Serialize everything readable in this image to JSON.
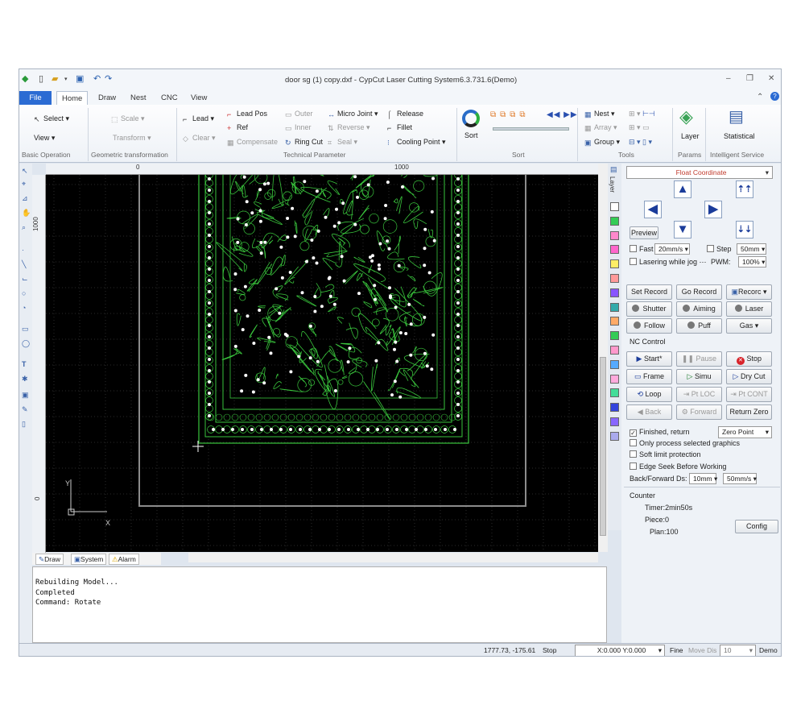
{
  "window": {
    "title": "door sg (1) copy.dxf - CypCut Laser Cutting System6.3.731.6(Demo)"
  },
  "tabs": [
    "File",
    "Home",
    "Draw",
    "Nest",
    "CNC",
    "View"
  ],
  "ribbon": {
    "basic": {
      "select": "Select",
      "view": "View",
      "label": "Basic Operation"
    },
    "geometric": {
      "scale": "Scale",
      "transform": "Transform",
      "label": "Geometric transformation"
    },
    "technical": {
      "lead": "Lead",
      "clear": "Clear",
      "lead_pos": "Lead Pos",
      "ref": "Ref",
      "compensate": "Compensate",
      "outer": "Outer",
      "inner": "Inner",
      "ring_cut": "Ring Cut",
      "micro_joint": "Micro Joint",
      "reverse": "Reverse",
      "seal": "Seal",
      "release": "Release",
      "fillet": "Fillet",
      "cooling_point": "Cooling Point",
      "label": "Technical Parameter"
    },
    "sort": {
      "sort": "Sort",
      "label": "Sort"
    },
    "tools": {
      "nest": "Nest",
      "array": "Array",
      "group": "Group",
      "label": "Tools"
    },
    "params": {
      "layer": "Layer",
      "label": "Params"
    },
    "intelligent": {
      "statistical": "Statistical",
      "label": "Intelligent Service"
    }
  },
  "rulers": {
    "top": [
      "0",
      "1000"
    ],
    "left": [
      "1000",
      "0"
    ]
  },
  "canvas": {
    "axis_y": "Y",
    "axis_x": "X"
  },
  "bottom_tabs": [
    "Draw",
    "System",
    "Alarm"
  ],
  "console_lines": [
    "Rebuilding Model...",
    "Completed",
    "Command: Rotate"
  ],
  "layer_strip_label": "Layer",
  "layer_colors": [
    "#ffffff",
    "#33cc55",
    "#ff88cc",
    "#ff66cc",
    "#ffee66",
    "#ff9999",
    "#8855ff",
    "#33aaaa",
    "#ffaa66",
    "#33cc55",
    "#ff99cc",
    "#55aaff",
    "#ffaadd",
    "#44dd99",
    "#3344dd",
    "#8866ff",
    "#aaaaee"
  ],
  "panel": {
    "coordinate_mode": "Float Coordinate",
    "preview": "Preview",
    "fast_label": "Fast",
    "fast_speed": "20mm/s",
    "step_label": "Step",
    "step_value": "50mm",
    "lasering_label": "Lasering while jog",
    "pwm_label": "PWM:",
    "pwm_value": "100%",
    "set_record": "Set Record",
    "go_record": "Go Record",
    "record": "Recorc",
    "shutter": "Shutter",
    "aiming": "Aiming",
    "laser": "Laser",
    "follow": "Follow",
    "puff": "Puff",
    "gas": "Gas",
    "nc_control": "NC Control",
    "start": "Start*",
    "pause": "Pause",
    "stop": "Stop",
    "frame": "Frame",
    "simu": "Simu",
    "dry_cut": "Dry Cut",
    "loop": "Loop",
    "pt_loc": "Pt LOC",
    "pt_cont": "Pt CONT",
    "back": "Back",
    "forward": "Forward",
    "return_zero": "Return Zero",
    "finished_return": "Finished, return",
    "zero_point": "Zero Point",
    "only_selected": "Only process selected graphics",
    "soft_limit": "Soft limit protection",
    "edge_seek": "Edge Seek Before Working",
    "back_forward_label": "Back/Forward Ds:",
    "back_forward_ds": "10mm",
    "back_forward_speed": "50mm/s",
    "counter": "Counter",
    "timer": "Timer:2min50s",
    "piece": "Piece:0",
    "plan": "Plan:100",
    "config": "Config"
  },
  "status": {
    "coords": "1777.73, -175.61",
    "state": "Stop",
    "xy": "X:0.000 Y:0.000",
    "fine": "Fine",
    "move_dis": "Move Dis",
    "move_value": "10",
    "mode": "Demo"
  },
  "colors": {
    "accent": "#2b6bd3",
    "pattern": "#39c43c",
    "canvas": "#000000"
  }
}
